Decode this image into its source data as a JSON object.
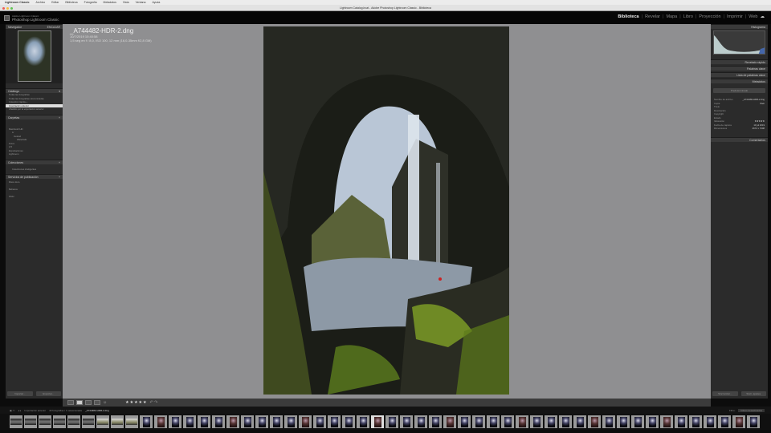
{
  "menubar": {
    "items": [
      "Lightroom Classic",
      "Archivo",
      "Editar",
      "Biblioteca",
      "Fotografía",
      "Metadatos",
      "Vista",
      "Ventana",
      "Ayuda"
    ]
  },
  "window": {
    "title": "Lightroom Catalog.lrcat - Adobe Photoshop Lightroom Classic - Biblioteca"
  },
  "identity": {
    "small": "Adobe Lightroom Classic",
    "name": "Photoshop Lightroom Classic"
  },
  "modules": [
    {
      "label": "Biblioteca",
      "active": true
    },
    {
      "label": "Revelar"
    },
    {
      "label": "Mapa"
    },
    {
      "label": "Libro"
    },
    {
      "label": "Proyección"
    },
    {
      "label": "Imprimir"
    },
    {
      "label": "Web"
    }
  ],
  "left": {
    "navigator": {
      "title": "Navegador",
      "zoom": "ENCAJAR"
    },
    "catalog": {
      "title": "Catálogo",
      "items": [
        {
          "label": "Todas las fotografías",
          "count": ""
        },
        {
          "label": "Todas las fotografías sincronizadas",
          "count": ""
        },
        {
          "label": "Colección rápida +",
          "count": ""
        },
        {
          "label": "Importación anterior",
          "count": "",
          "selected": true
        },
        {
          "label": "Añadido por la exportación anterior",
          "count": ""
        }
      ]
    },
    "folders": {
      "title": "Carpetas",
      "items": [
        "Macintosh HD",
        "Lr",
        "Iceland",
        "Waterfalls",
        "Fotos",
        "Lr5",
        "Exportaciones",
        "Lightroom"
      ]
    },
    "collections": {
      "title": "Colecciones",
      "items": [
        "Colecciones inteligentes"
      ]
    },
    "publish": {
      "title": "Servicios de publicación",
      "items": [
        "Disco duro",
        "Behance",
        "Flickr"
      ]
    },
    "import_label": "Importar...",
    "export_label": "Exportar..."
  },
  "photo": {
    "filename": "_A744482-HDR-2.dng",
    "date": "10/7/2019 10:40:58",
    "exif": "1,5 seg en f / 8,0, ISO 100, 12 mm (16,0-35mm f/2,8 GM)"
  },
  "right": {
    "histogram": "Histograma",
    "quick_develop": "Revelado rápido",
    "keywording": "Palabras clave",
    "keyword_list": "Lista de palabras clave",
    "metadata": "Metadatos",
    "metadata_preset": "Predeterminado",
    "metadata_fields": [
      {
        "label": "Nombre de archivo",
        "value": "_A744482-HDR-2.dng"
      },
      {
        "label": "Copia",
        "value": "Web"
      },
      {
        "label": "Título",
        "value": ""
      },
      {
        "label": "Descripción",
        "value": ""
      },
      {
        "label": "Copyright",
        "value": ""
      },
      {
        "label": "Estado",
        "value": ""
      },
      {
        "label": "Valoración",
        "value": "★★★★★"
      },
      {
        "label": "Fecha de captura",
        "value": "10 jul 2019"
      },
      {
        "label": "Dimensiones",
        "value": "4672 x 7008"
      }
    ],
    "comments": "Comentarios",
    "sync_label": "Sincronizar...",
    "sync_settings_label": "Sincr. ajustes"
  },
  "toolbar": {
    "rating": "★★★★★"
  },
  "filmstrip": {
    "source": "Importación anterior",
    "path": "40 fotografías / 1 seleccionada",
    "selected_file": "_A744482-HDR-2.dng",
    "filter_label": "Filtro:",
    "filter_value": "Filtros desactivados"
  },
  "colors": {
    "accent": "#dddddd",
    "center_bg": "#8f8f91",
    "panel_bg": "#2b2b2b"
  }
}
